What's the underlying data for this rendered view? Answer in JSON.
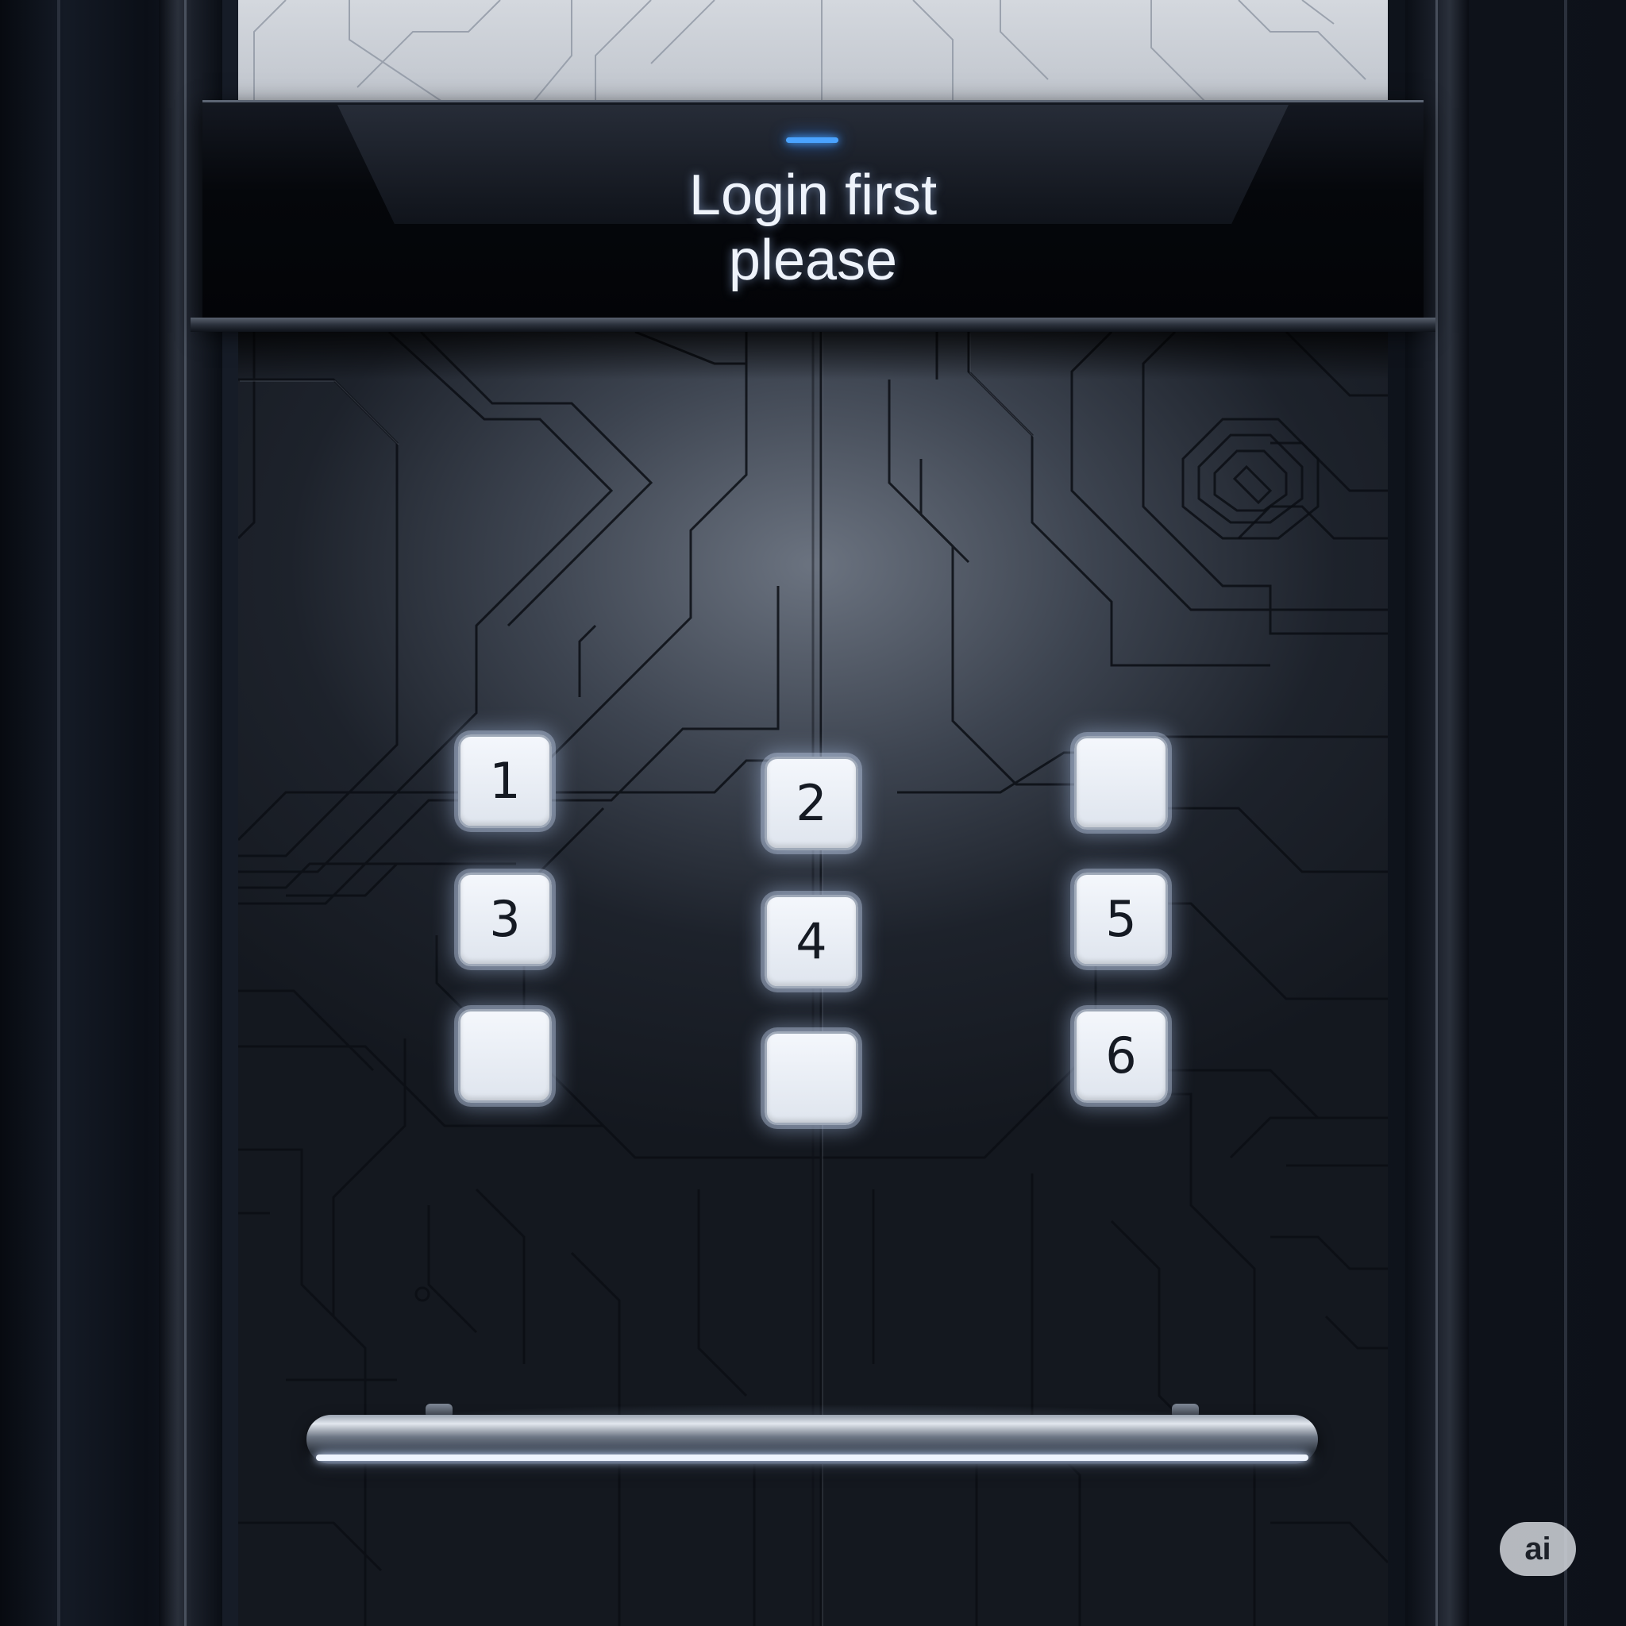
{
  "display": {
    "message_line1": "Login first",
    "message_line2": "please",
    "led_color": "#4aa3ff"
  },
  "keypad": {
    "keys": [
      {
        "id": "1",
        "label": "1"
      },
      {
        "id": "2",
        "label": "2"
      },
      {
        "id": "blank-a",
        "label": ""
      },
      {
        "id": "3",
        "label": "3"
      },
      {
        "id": "4",
        "label": "4"
      },
      {
        "id": "5",
        "label": "5"
      },
      {
        "id": "blank-b",
        "label": ""
      },
      {
        "id": "blank-c",
        "label": ""
      },
      {
        "id": "6",
        "label": "6"
      }
    ]
  },
  "watermark": {
    "text": "ai"
  },
  "colors": {
    "panel": "#1d222b",
    "key_face": "#eef2f8",
    "key_glow": "#b4cdf5",
    "display_text": "#eef3fb"
  }
}
